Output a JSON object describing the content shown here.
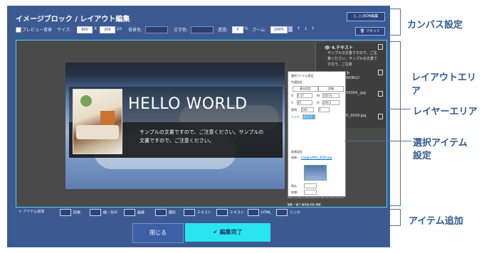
{
  "editor": {
    "title": "イメージブロック / レイアウト編集",
    "json_button": "{...} JSON編集",
    "reset_button": "リセット",
    "toolbar": {
      "preview_bg_label": "プレビュー背景",
      "size_label": "サイズ:",
      "width_value": "600",
      "x_sep": "X",
      "height_value": "200",
      "px_unit": "px",
      "bg_color_label": "背景色:",
      "text_color_label": "文字色:",
      "opacity_label": "透過:",
      "opacity_value": "0",
      "percent": "%",
      "zoom_label": "ズーム:",
      "zoom_value": "100%"
    }
  },
  "canvas": {
    "hello_text": "HELLO WORLD",
    "sample_text": "サンプルの文書ですので、ご注意ください。サンプルの文書ですので、ご注意ください。"
  },
  "layers": {
    "items": [
      {
        "title": "4.テキスト",
        "desc": "サンプルの文書ですので、ご注意ください。サンプルの文書ですので、ご注意"
      },
      {
        "title": "ト",
        "desc": "WORLD"
      },
      {
        "title": "",
        "desc": "0X004_.jpg"
      },
      {
        "title": "",
        "desc": "G_0509.jpg"
      }
    ]
  },
  "props": {
    "section_title": "選択アイテム設定",
    "common_label": "共通設定",
    "basic_tab": "基本設定",
    "detail_tab": "詳細",
    "x_label": "X:",
    "x_value": "0.17",
    "w_label": "W:",
    "w_value": "100.%",
    "y_label": "Y:",
    "y_value": "45",
    "h_label": "H:",
    "h_value": "209.5",
    "opacity_label": "透明",
    "opacity_value": "100",
    "rot_value": "0",
    "link_label": "リンク",
    "link_value": "#L2-2",
    "image_section": "画像設定",
    "image_label": "画像:",
    "image_path": "images/IMG_0509.jpg",
    "corner_label": "角丸:",
    "border_label": "枠線:",
    "footer_text": "style=\"position:absolute;top:0;left:0%;width:100%;height:48.4%\"",
    "action_labels": [
      "編集",
      "一番下",
      "最背面",
      "削除",
      "移動"
    ]
  },
  "bottom_bar": {
    "add_item": "アイテム追加",
    "items": [
      "四角",
      "線・矢印",
      "画像",
      "図形",
      "テキスト",
      "テキスト",
      "HTML",
      "リンク"
    ]
  },
  "actions": {
    "close": "閉じる",
    "done": "✔ 編集完了"
  },
  "annotations": {
    "canvas_settings": "カンバス設定",
    "layout_area": "レイアウトエリア",
    "layer_area": "レイヤーエリア",
    "selected_item_line1": "選択アイテム",
    "selected_item_line2": "設定",
    "item_add": "アイテム追加"
  },
  "colors": {
    "editor_bg": "#3c5a92",
    "accent_cyan": "#29e6ee",
    "annotation": "#355a92"
  }
}
